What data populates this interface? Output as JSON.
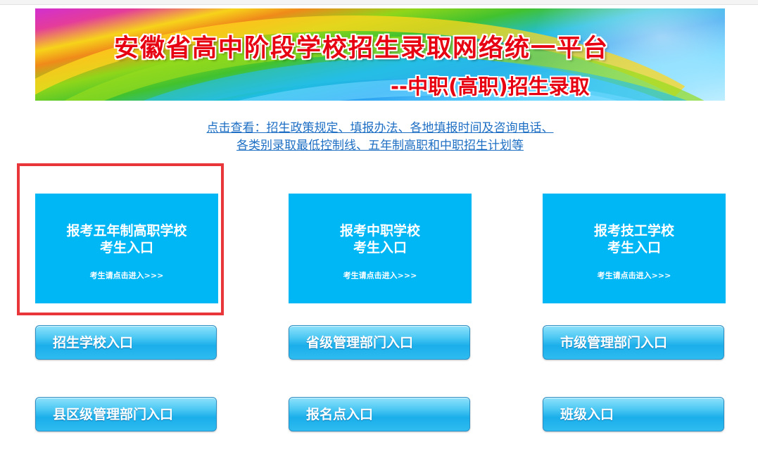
{
  "banner": {
    "title": "安徽省高中阶段学校招生录取网络统一平台",
    "subtitle": "--中职(高职)招生录取"
  },
  "notice": {
    "line1": "点击查看：招生政策规定、填报办法、各地填报时间及咨询电话、",
    "line2": "各类别录取最低控制线、五年制高职和中职招生计划等"
  },
  "cards": [
    {
      "line1": "报考五年制高职学校",
      "line2": "考生入口",
      "hint": "考生请点击进入>>>"
    },
    {
      "line1": "报考中职学校",
      "line2": "考生入口",
      "hint": "考生请点击进入>>>"
    },
    {
      "line1": "报考技工学校",
      "line2": "考生入口",
      "hint": "考生请点击进入>>>"
    }
  ],
  "buttons": [
    "招生学校入口",
    "省级管理部门入口",
    "市级管理部门入口",
    "县区级管理部门入口",
    "报名点入口",
    "班级入口"
  ],
  "colors": {
    "card_bg": "#00b7f6",
    "title_red": "#e60012",
    "link_blue": "#1e6fc4",
    "highlight_red": "#e8363b"
  }
}
